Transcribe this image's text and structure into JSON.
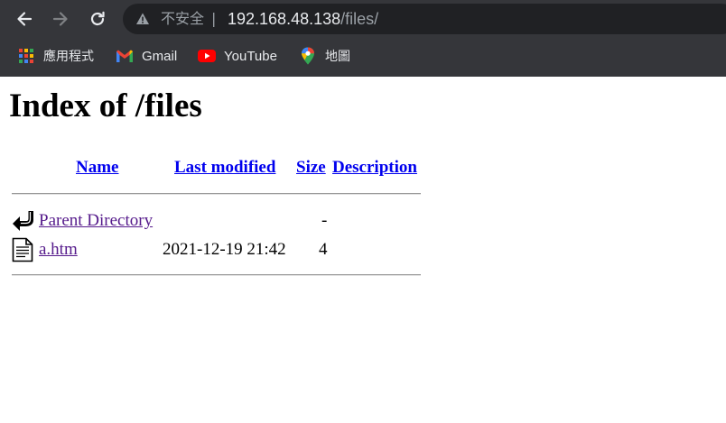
{
  "browser": {
    "security_label": "不安全",
    "url_separator": "|",
    "url_host": "192.168.48.138",
    "url_path": "/files/",
    "bookmarks": [
      {
        "label": "應用程式",
        "icon": "apps-grid-icon"
      },
      {
        "label": "Gmail",
        "icon": "gmail-icon"
      },
      {
        "label": "YouTube",
        "icon": "youtube-icon"
      },
      {
        "label": "地圖",
        "icon": "maps-icon"
      }
    ]
  },
  "page": {
    "title": "Index of /files",
    "columns": {
      "name": "Name",
      "last_modified": "Last modified",
      "size": "Size",
      "description": "Description"
    },
    "rows": [
      {
        "icon": "back-arrow-icon",
        "name": "Parent Directory",
        "last_modified": "",
        "size": "-",
        "description": ""
      },
      {
        "icon": "text-file-icon",
        "name": "a.htm",
        "last_modified": "2021-12-19 21:42",
        "size": "4",
        "description": ""
      }
    ]
  },
  "colors": {
    "chrome_bg": "#35363a",
    "omnibox_bg": "#202124",
    "link": "#0000ee",
    "visited_link": "#551a8b"
  }
}
